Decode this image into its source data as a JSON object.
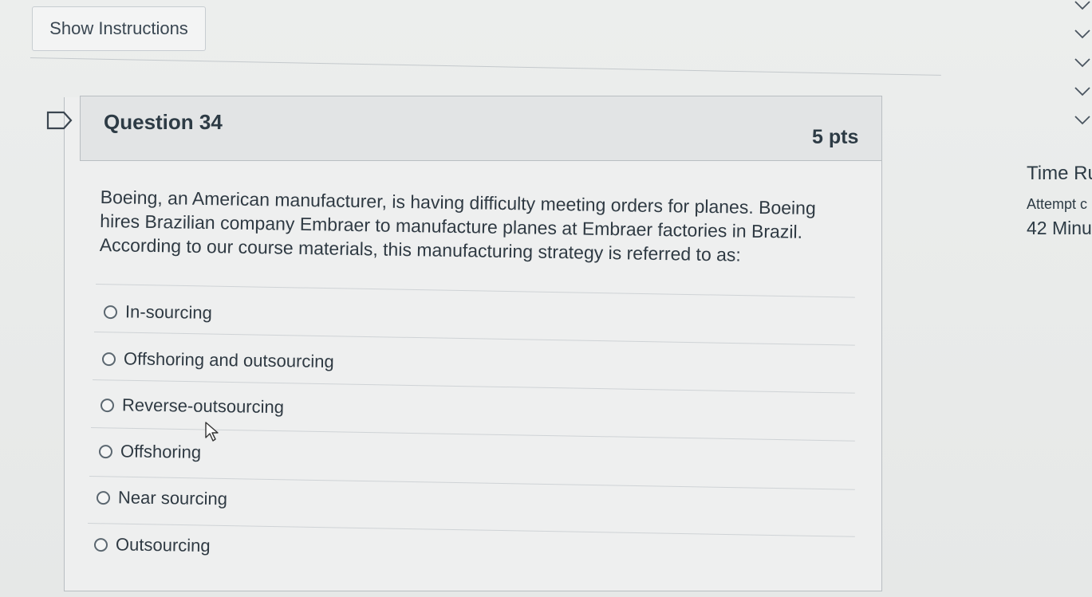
{
  "toolbar": {
    "show_instructions_label": "Show Instructions"
  },
  "question": {
    "title": "Question 34",
    "points": "5 pts",
    "text": "Boeing, an American manufacturer, is having difficulty meeting orders for planes.  Boeing hires Brazilian company Embraer to manufacture planes at Embraer factories in Brazil. According to our course materials, this manufacturing strategy is referred to as:",
    "answers": [
      {
        "label": "In-sourcing",
        "selected": false
      },
      {
        "label": "Offshoring and outsourcing",
        "selected": false
      },
      {
        "label": "Reverse-outsourcing",
        "selected": false
      },
      {
        "label": "Offshoring",
        "selected": false
      },
      {
        "label": "Near sourcing",
        "selected": false
      },
      {
        "label": "Outsourcing",
        "selected": false
      }
    ]
  },
  "sidebar": {
    "time_label": "Time Ru",
    "attempt_label": "Attempt c",
    "minutes_label": "42 Minu"
  },
  "icons": {
    "flag": "flag-icon",
    "cursor": "mouse-pointer-icon",
    "check": "check-icon"
  },
  "colors": {
    "background": "#eceeed",
    "header_bg": "#e2e4e5",
    "text": "#2d3b45",
    "border": "#b9bec2"
  }
}
